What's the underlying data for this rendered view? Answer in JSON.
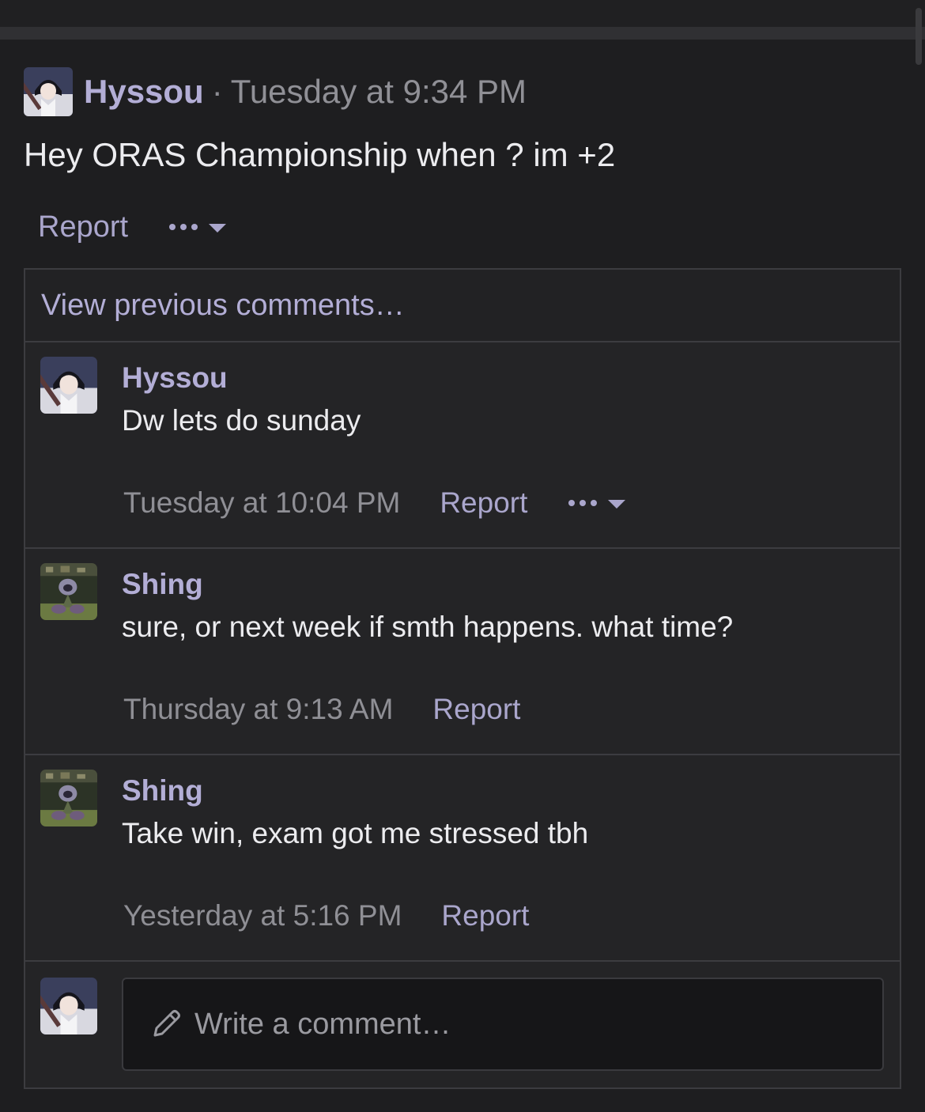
{
  "post": {
    "author": "Hyssou",
    "separator": "·",
    "time": "Tuesday at 9:34 PM",
    "body": "Hey ORAS Championship when ? im +2",
    "report_label": "Report",
    "avatar_icon": "hyssou-avatar-icon",
    "more_icon": "more-options-icon"
  },
  "comments_section": {
    "view_previous_label": "View previous comments…",
    "comments": [
      {
        "author": "Hyssou",
        "text": "Dw lets do sunday",
        "time": "Tuesday at 10:04 PM",
        "report_label": "Report",
        "avatar_icon": "hyssou-avatar-icon",
        "has_more_menu": true
      },
      {
        "author": "Shing",
        "text": "sure, or next week if smth happens. what time?",
        "time": "Thursday at 9:13 AM",
        "report_label": "Report",
        "avatar_icon": "shing-avatar-icon",
        "has_more_menu": false
      },
      {
        "author": "Shing",
        "text": "Take win, exam got me stressed tbh",
        "time": "Yesterday at 5:16 PM",
        "report_label": "Report",
        "avatar_icon": "shing-avatar-icon",
        "has_more_menu": false
      }
    ],
    "write_placeholder": "Write a comment…",
    "pencil_icon": "pencil-icon"
  },
  "colors": {
    "background": "#1e1e20",
    "accent_link": "#b3aed6",
    "text": "#ececef",
    "muted": "#909096"
  }
}
